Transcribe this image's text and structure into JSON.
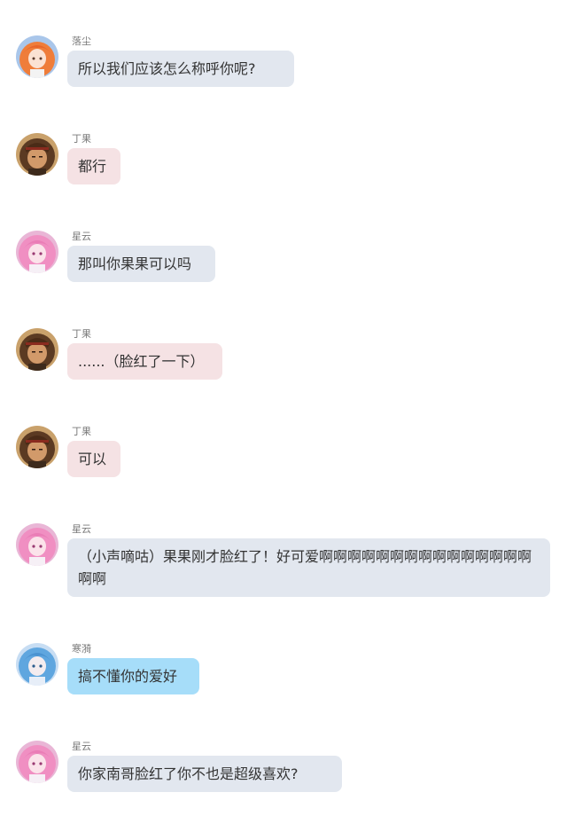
{
  "colors": {
    "bubble_grey": "#e2e7ef",
    "bubble_pink": "#f5e2e4",
    "bubble_blue": "#a6ddf9",
    "name_text": "#7a7a7a",
    "message_text": "#333333"
  },
  "messages": [
    {
      "name": "落尘",
      "text": "所以我们应该怎么称呼你呢?",
      "avatar_icon": "orange-hair-girl-avatar-icon",
      "bubble": "grey"
    },
    {
      "name": "丁果",
      "text": "都行",
      "avatar_icon": "brown-hair-boy-avatar-icon",
      "bubble": "pink"
    },
    {
      "name": "星云",
      "text": "那叫你果果可以吗",
      "avatar_icon": "pink-hair-girl-avatar-icon",
      "bubble": "grey"
    },
    {
      "name": "丁果",
      "text": "......（脸红了一下）",
      "avatar_icon": "brown-hair-boy-avatar-icon",
      "bubble": "pink"
    },
    {
      "name": "丁果",
      "text": "可以",
      "avatar_icon": "brown-hair-boy-avatar-icon",
      "bubble": "pink"
    },
    {
      "name": "星云",
      "text": "（小声嘀咕）果果刚才脸红了！好可爱啊啊啊啊啊啊啊啊啊啊啊啊啊啊啊啊啊",
      "avatar_icon": "pink-hair-girl-avatar-icon",
      "bubble": "grey"
    },
    {
      "name": "寒漪",
      "text": "搞不懂你的爱好",
      "avatar_icon": "blue-hair-girl-avatar-icon",
      "bubble": "blue"
    },
    {
      "name": "星云",
      "text": "你家南哥脸红了你不也是超级喜欢?",
      "avatar_icon": "pink-hair-girl-avatar-icon",
      "bubble": "grey"
    }
  ]
}
